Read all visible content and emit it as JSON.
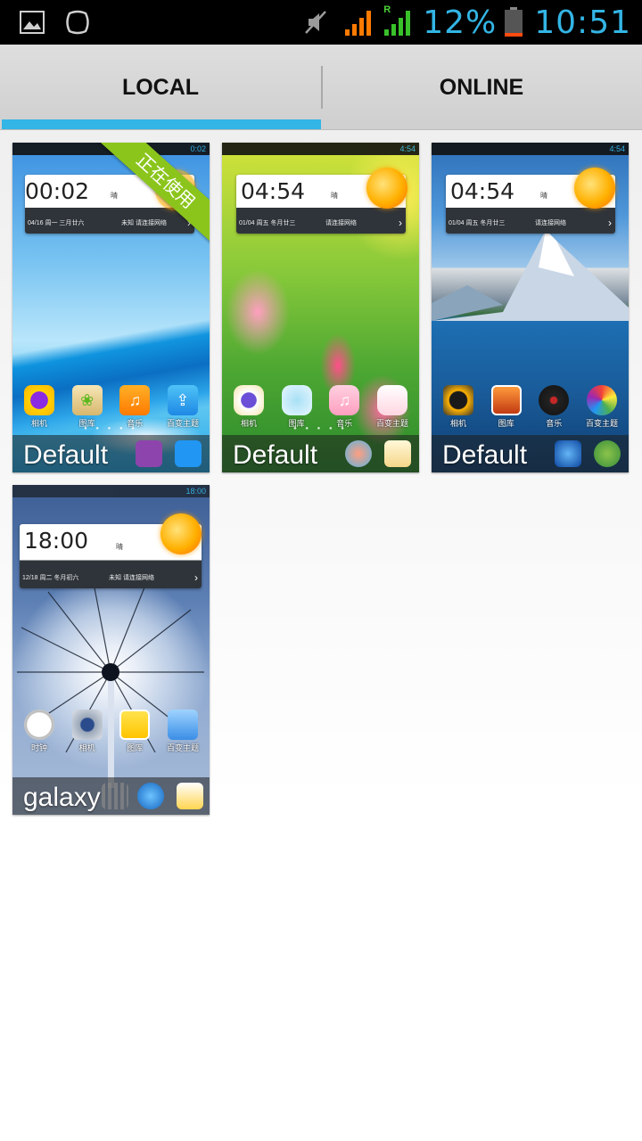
{
  "status_bar": {
    "icons_left": [
      "gallery-icon",
      "notification-blob-icon"
    ],
    "icons_right": [
      "muted-icon",
      "signal-orange-icon",
      "signal-green-roaming-icon"
    ],
    "roaming_mark": "R",
    "battery_percent": "12%",
    "battery_level": 0.12,
    "time": "10:51"
  },
  "tabs": [
    {
      "label": "LOCAL",
      "selected": true
    },
    {
      "label": "ONLINE",
      "selected": false
    }
  ],
  "accent_color": "#33b5e5",
  "themes": [
    {
      "name": "Default",
      "in_use_badge": "正在使用",
      "preview": {
        "status_time": "0:02",
        "clock": "00:02",
        "weather": "晴",
        "date": "04/16 周一  三月廿六",
        "location": "未知 请连接网络",
        "apps": [
          "相机",
          "图库",
          "音乐",
          "百变主题"
        ]
      }
    },
    {
      "name": "Default",
      "preview": {
        "status_time": "4:54",
        "clock": "04:54",
        "weather": "晴",
        "date": "01/04 周五 冬月廿三",
        "location": "请连接网络",
        "apps": [
          "相机",
          "图库",
          "音乐",
          "百变主题"
        ]
      }
    },
    {
      "name": "Default",
      "preview": {
        "status_time": "4:54",
        "clock": "04:54",
        "weather": "晴",
        "date": "01/04 周五 冬月廿三",
        "location": "请连接网络",
        "apps": [
          "相机",
          "图库",
          "音乐",
          "百变主题"
        ]
      }
    },
    {
      "name": "galaxy",
      "preview": {
        "status_time": "18:00",
        "clock": "18:00",
        "weather": "晴",
        "date": "12/18 周二  冬月初六",
        "location": "未知  请连接网络",
        "apps": [
          "时钟",
          "相机",
          "图库",
          "百变主题"
        ]
      }
    }
  ]
}
